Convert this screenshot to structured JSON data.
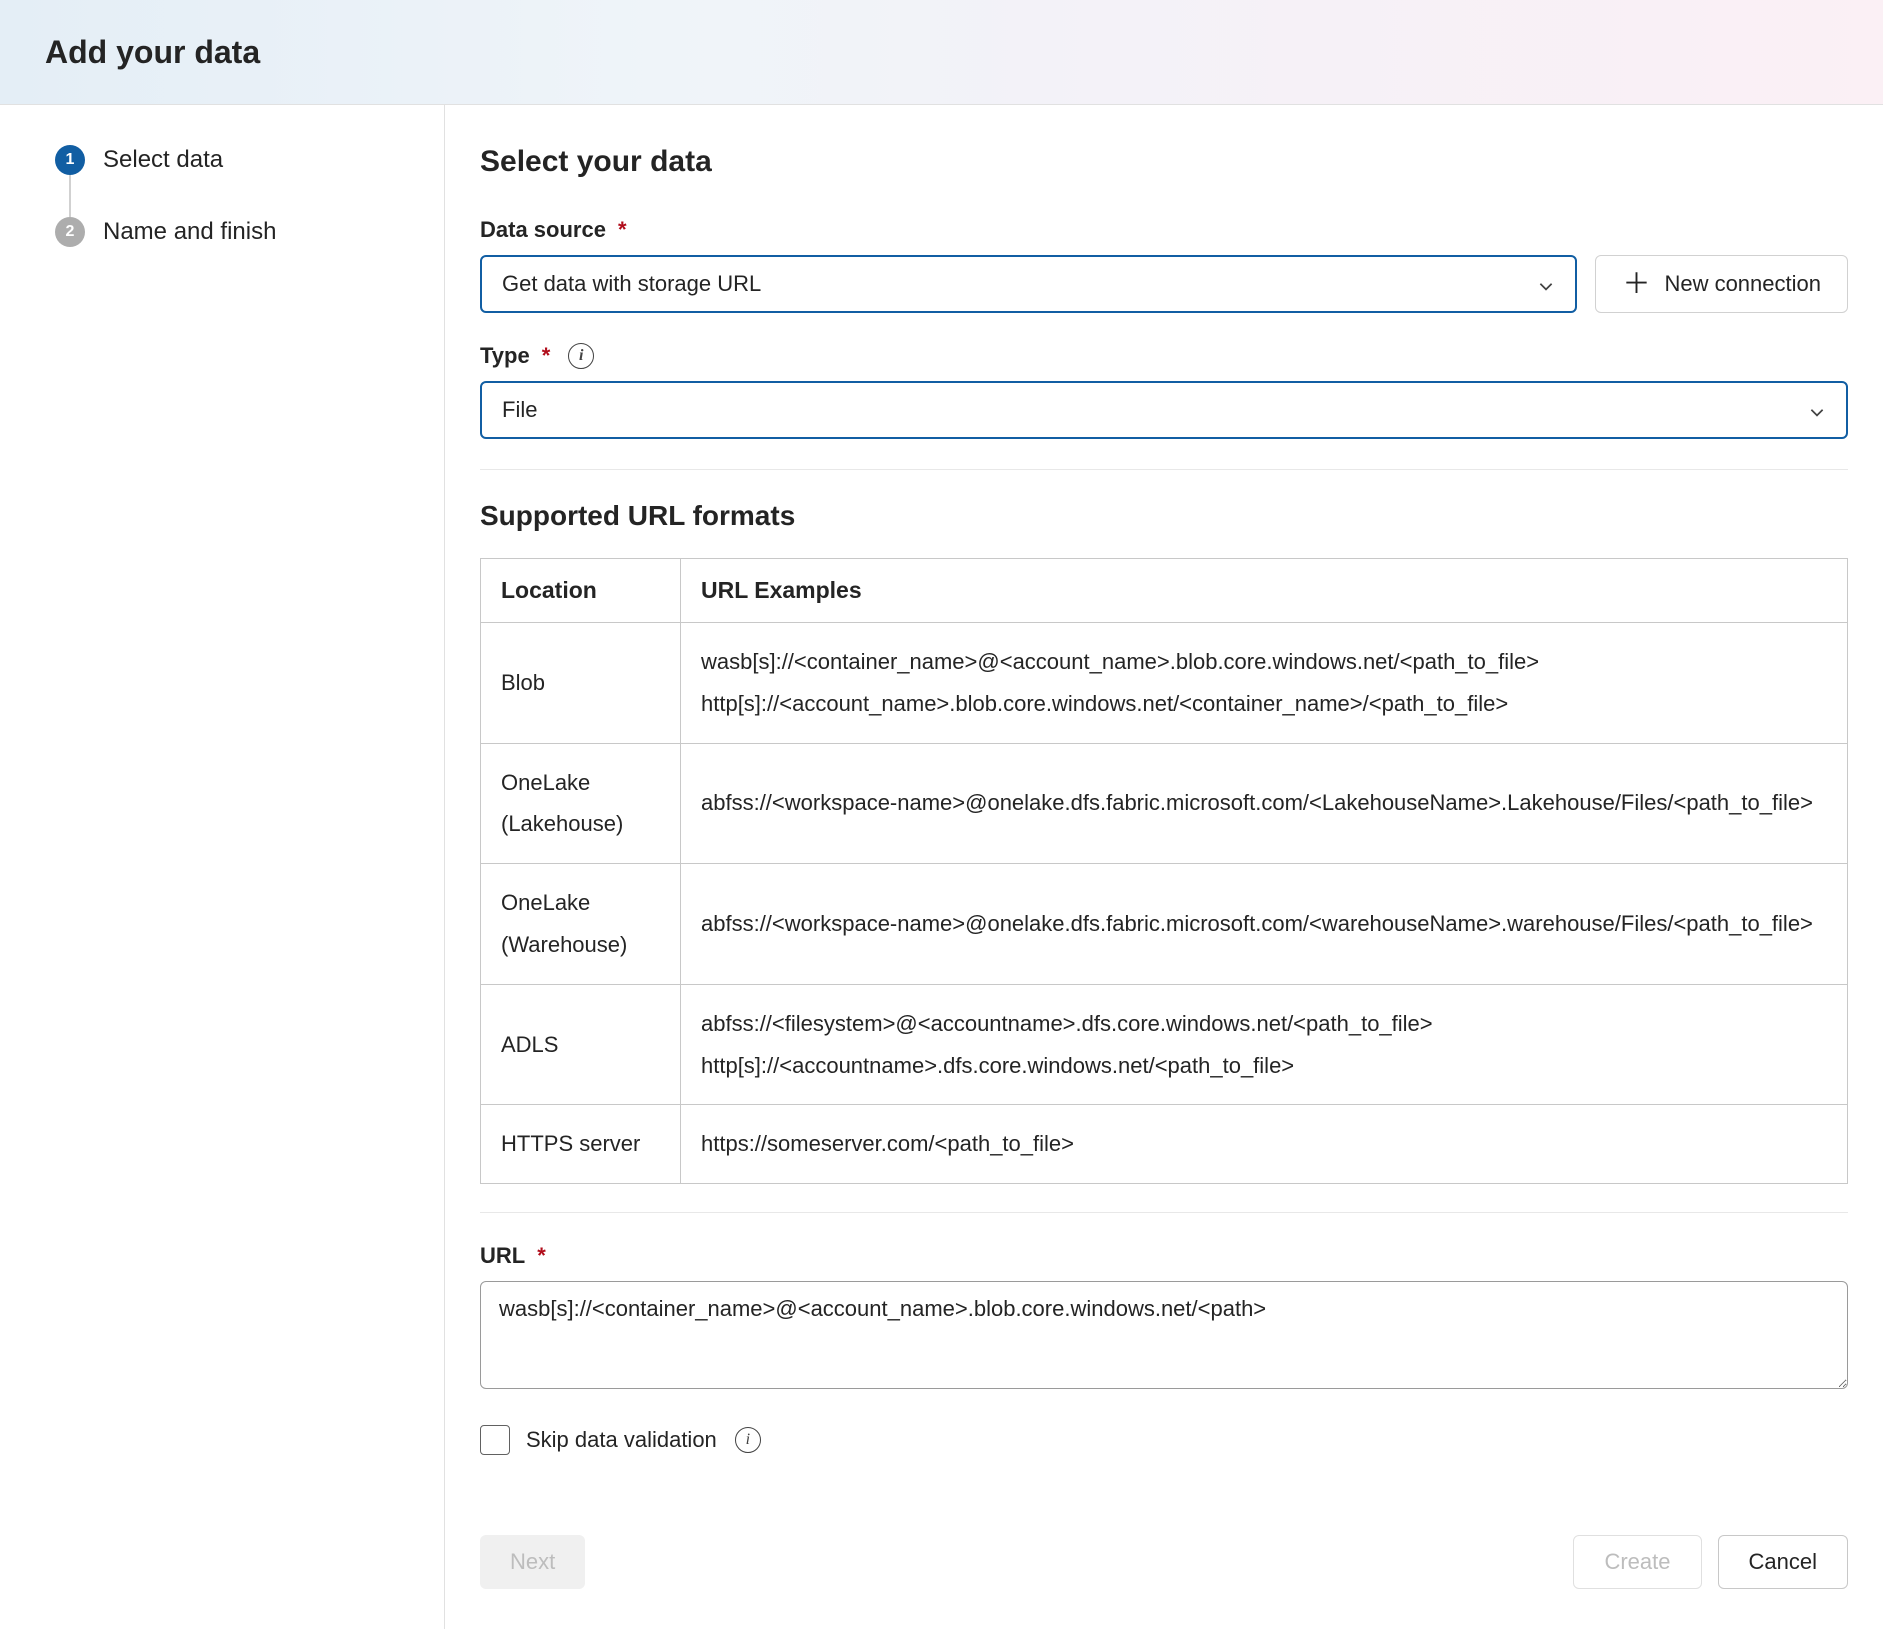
{
  "header": {
    "title": "Add your data"
  },
  "sidebar": {
    "steps": [
      {
        "num": "1",
        "label": "Select data",
        "active": true
      },
      {
        "num": "2",
        "label": "Name and finish",
        "active": false
      }
    ]
  },
  "main": {
    "page_title": "Select your data",
    "data_source": {
      "label": "Data source",
      "value": "Get data with storage URL",
      "new_connection_label": "New connection"
    },
    "type": {
      "label": "Type",
      "value": "File"
    },
    "formats": {
      "title": "Supported URL formats",
      "columns": [
        "Location",
        "URL Examples"
      ],
      "rows": [
        {
          "location": "Blob",
          "examples": "wasb[s]://<container_name>@<account_name>.blob.core.windows.net/<path_to_file>\nhttp[s]://<account_name>.blob.core.windows.net/<container_name>/<path_to_file>"
        },
        {
          "location": "OneLake (Lakehouse)",
          "examples": "abfss://<workspace-name>@onelake.dfs.fabric.microsoft.com/<LakehouseName>.Lakehouse/Files/<path_to_file>"
        },
        {
          "location": "OneLake (Warehouse)",
          "examples": "abfss://<workspace-name>@onelake.dfs.fabric.microsoft.com/<warehouseName>.warehouse/Files/<path_to_file>"
        },
        {
          "location": "ADLS",
          "examples": "abfss://<filesystem>@<accountname>.dfs.core.windows.net/<path_to_file>\nhttp[s]://<accountname>.dfs.core.windows.net/<path_to_file>"
        },
        {
          "location": "HTTPS server",
          "examples": "https://someserver.com/<path_to_file>"
        }
      ]
    },
    "url": {
      "label": "URL",
      "value": "wasb[s]://<container_name>@<account_name>.blob.core.windows.net/<path>"
    },
    "skip_validation_label": "Skip data validation",
    "footer": {
      "next": "Next",
      "create": "Create",
      "cancel": "Cancel"
    }
  }
}
